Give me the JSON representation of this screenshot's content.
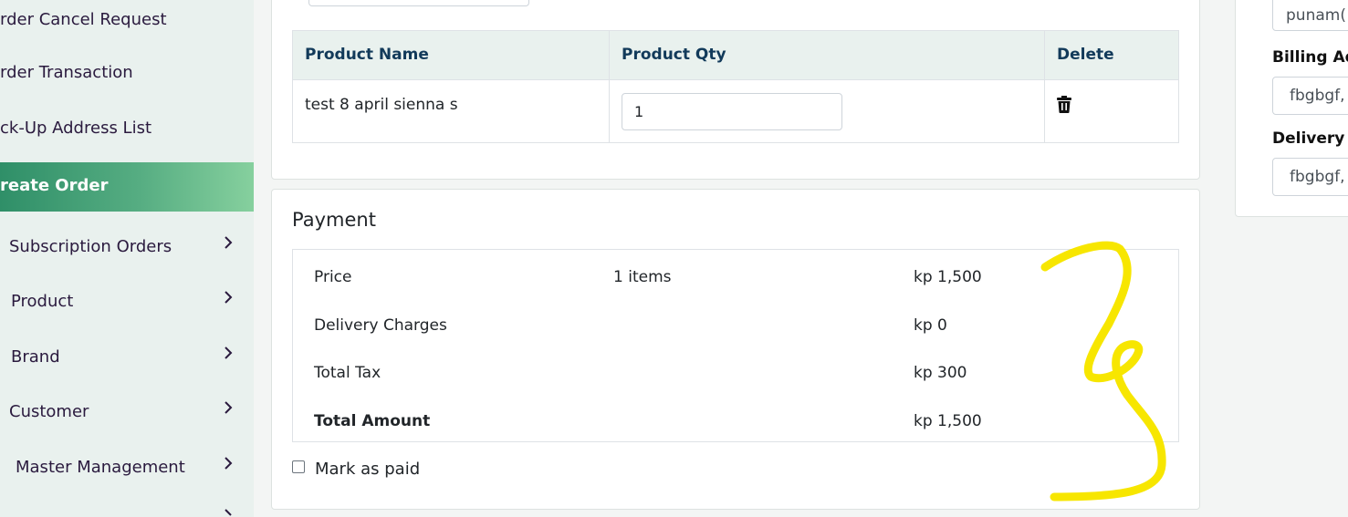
{
  "sidebar": {
    "items": [
      {
        "label": "rder Cancel Request",
        "has_chevron": false
      },
      {
        "label": "rder Transaction",
        "has_chevron": false
      },
      {
        "label": "ck-Up Address List",
        "has_chevron": false
      },
      {
        "label": "reate Order",
        "has_chevron": false,
        "active": true
      },
      {
        "label": "Subscription Orders",
        "has_chevron": true
      },
      {
        "label": "Product",
        "has_chevron": true
      },
      {
        "label": "Brand",
        "has_chevron": true
      },
      {
        "label": "Customer",
        "has_chevron": true
      },
      {
        "label": "Master Management",
        "has_chevron": true
      }
    ]
  },
  "products": {
    "headers": {
      "name": "Product Name",
      "qty": "Product Qty",
      "delete": "Delete"
    },
    "rows": [
      {
        "name": "test 8 april sienna s",
        "qty": "1",
        "delete_icon": "trash-icon"
      }
    ]
  },
  "payment": {
    "title": "Payment",
    "price_label": "Price",
    "items_count": "1 items",
    "price_value": "kp 1,500",
    "delivery_label": "Delivery Charges",
    "delivery_value": "kp 0",
    "tax_label": "Total Tax",
    "tax_value": "kp 300",
    "total_label": "Total Amount",
    "total_value": "kp 1,500",
    "mark_paid_label": "Mark as paid",
    "mark_paid_checked": false
  },
  "right_panel": {
    "email_value": "punam(",
    "billing_label": "Billing Ad",
    "billing_value": "fbgbgf,",
    "delivery_label": "Delivery A",
    "delivery_value": "fbgbgf,"
  },
  "colors": {
    "accent_green": "#2f8f68",
    "sidebar_bg": "#e9f1ee",
    "header_text": "#123a5a",
    "scribble": "#f7e600"
  }
}
